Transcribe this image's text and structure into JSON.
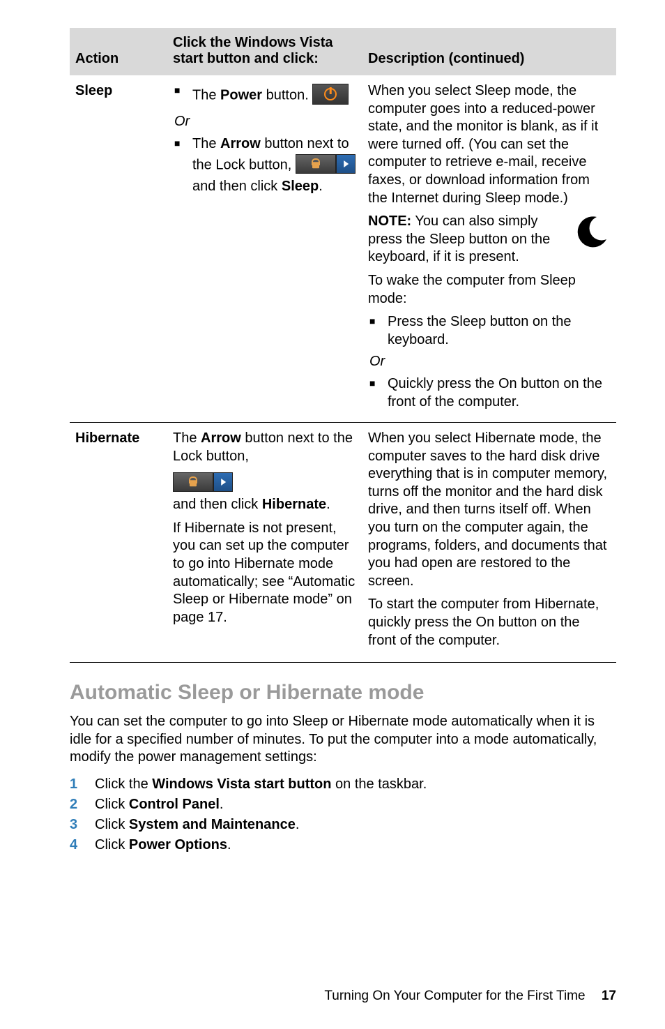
{
  "table": {
    "headers": {
      "action": "Action",
      "click": "Click the Windows Vista start button and click:",
      "desc": "Description (continued)"
    },
    "rows": {
      "sleep": {
        "action": "Sleep",
        "click_item1_pre": "The ",
        "click_item1_bold": "Power",
        "click_item1_post": " button.",
        "or": "Or",
        "click_item2_pre": "The ",
        "click_item2_bold": "Arrow",
        "click_item2_post": " button next to the Lock button,",
        "click_item2_tail_pre": "and then click ",
        "click_item2_tail_bold": "Sleep",
        "click_item2_tail_post": ".",
        "desc_p1": "When you select Sleep mode, the computer goes into a reduced-power state, and the monitor is blank, as if it were turned off. (You can set the computer to retrieve e-mail, receive faxes, or download information from the Internet during Sleep mode.)",
        "note_label": "NOTE:",
        "note_text": " You can also simply press the Sleep button on the keyboard, if it is present.",
        "desc_p2": "To wake the computer from Sleep mode:",
        "desc_b1": "Press the Sleep button on the keyboard.",
        "desc_or": "Or",
        "desc_b2": "Quickly press the On button on the front of the computer."
      },
      "hibernate": {
        "action": "Hibernate",
        "click_l1_pre": "The ",
        "click_l1_bold": "Arrow",
        "click_l1_post": " button next to the Lock button,",
        "click_l2_pre": "and then click ",
        "click_l2_bold": "Hibernate",
        "click_l2_post": ".",
        "click_p2": "If Hibernate is not present, you can set up the computer to go into Hibernate mode automatically; see “Automatic Sleep or Hibernate mode” on page 17.",
        "desc_p1": "When you select Hibernate mode, the computer saves to the hard disk drive everything that is in computer memory, turns off the monitor and the hard disk drive, and then turns itself off. When you turn on the computer again, the programs, folders, and documents that you had open are restored to the screen.",
        "desc_p2": "To start the computer from Hibernate, quickly press the On button on the front of the computer."
      }
    }
  },
  "section_title": "Automatic Sleep or Hibernate mode",
  "section_body": "You can set the computer to go into Sleep or Hibernate mode automatically when it is idle for a specified number of minutes. To put the computer into a mode automatically, modify the power management settings:",
  "steps": [
    {
      "num": "1",
      "pre": "Click the ",
      "bold": "Windows Vista start button",
      "post": " on the taskbar."
    },
    {
      "num": "2",
      "pre": "Click ",
      "bold": "Control Panel",
      "post": "."
    },
    {
      "num": "3",
      "pre": "Click ",
      "bold": "System and Maintenance",
      "post": "."
    },
    {
      "num": "4",
      "pre": "Click ",
      "bold": "Power Options",
      "post": "."
    }
  ],
  "footer_text": "Turning On Your Computer for the First Time",
  "footer_page": "17"
}
